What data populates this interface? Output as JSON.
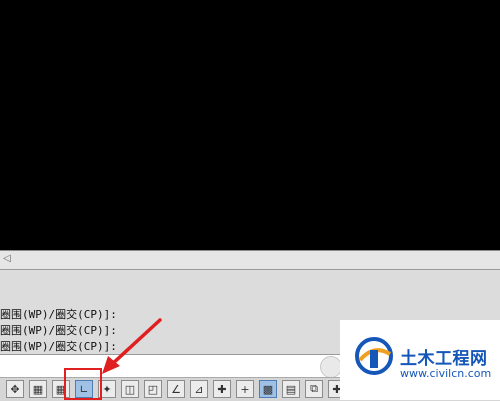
{
  "canvas": {
    "background": "#000000"
  },
  "command_history": {
    "lines": [
      "圈围(WP)/圈交(CP)]:",
      "圈围(WP)/圈交(CP)]:",
      "圈围(WP)/圈交(CP)]:"
    ]
  },
  "status_bar": {
    "buttons": [
      {
        "name": "snap-move-icon",
        "glyph": "✥",
        "active": false
      },
      {
        "name": "grid-small-icon",
        "glyph": "▦",
        "active": false
      },
      {
        "name": "grid-display-icon",
        "glyph": "▦",
        "active": false
      },
      {
        "name": "ortho-mode-icon",
        "glyph": "∟",
        "active": true
      },
      {
        "name": "polar-tracking-icon",
        "glyph": "✦",
        "active": false
      },
      {
        "name": "object-snap-icon",
        "glyph": "◫",
        "active": false
      },
      {
        "name": "3d-snap-icon",
        "glyph": "◰",
        "active": false
      },
      {
        "name": "angle-icon",
        "glyph": "∠",
        "active": false
      },
      {
        "name": "dynamic-ucs-icon",
        "glyph": "⊿",
        "active": false
      },
      {
        "name": "dynamic-input-icon",
        "glyph": "✚",
        "active": false
      },
      {
        "name": "lineweight-icon",
        "glyph": "+",
        "active": false
      },
      {
        "name": "transparency-icon",
        "glyph": "▩",
        "active": true
      },
      {
        "name": "selection-cycling-icon",
        "glyph": "▤",
        "active": false
      },
      {
        "name": "annotation-monitor-icon",
        "glyph": "⧉",
        "active": false
      },
      {
        "name": "plus-icon",
        "glyph": "✚",
        "active": false
      }
    ]
  },
  "logo": {
    "title": "土木工程网",
    "url": "www.civilcn.com",
    "colors": {
      "blue": "#1457b8",
      "orange": "#f0a020"
    }
  },
  "annotation": {
    "color": "#e02020"
  }
}
